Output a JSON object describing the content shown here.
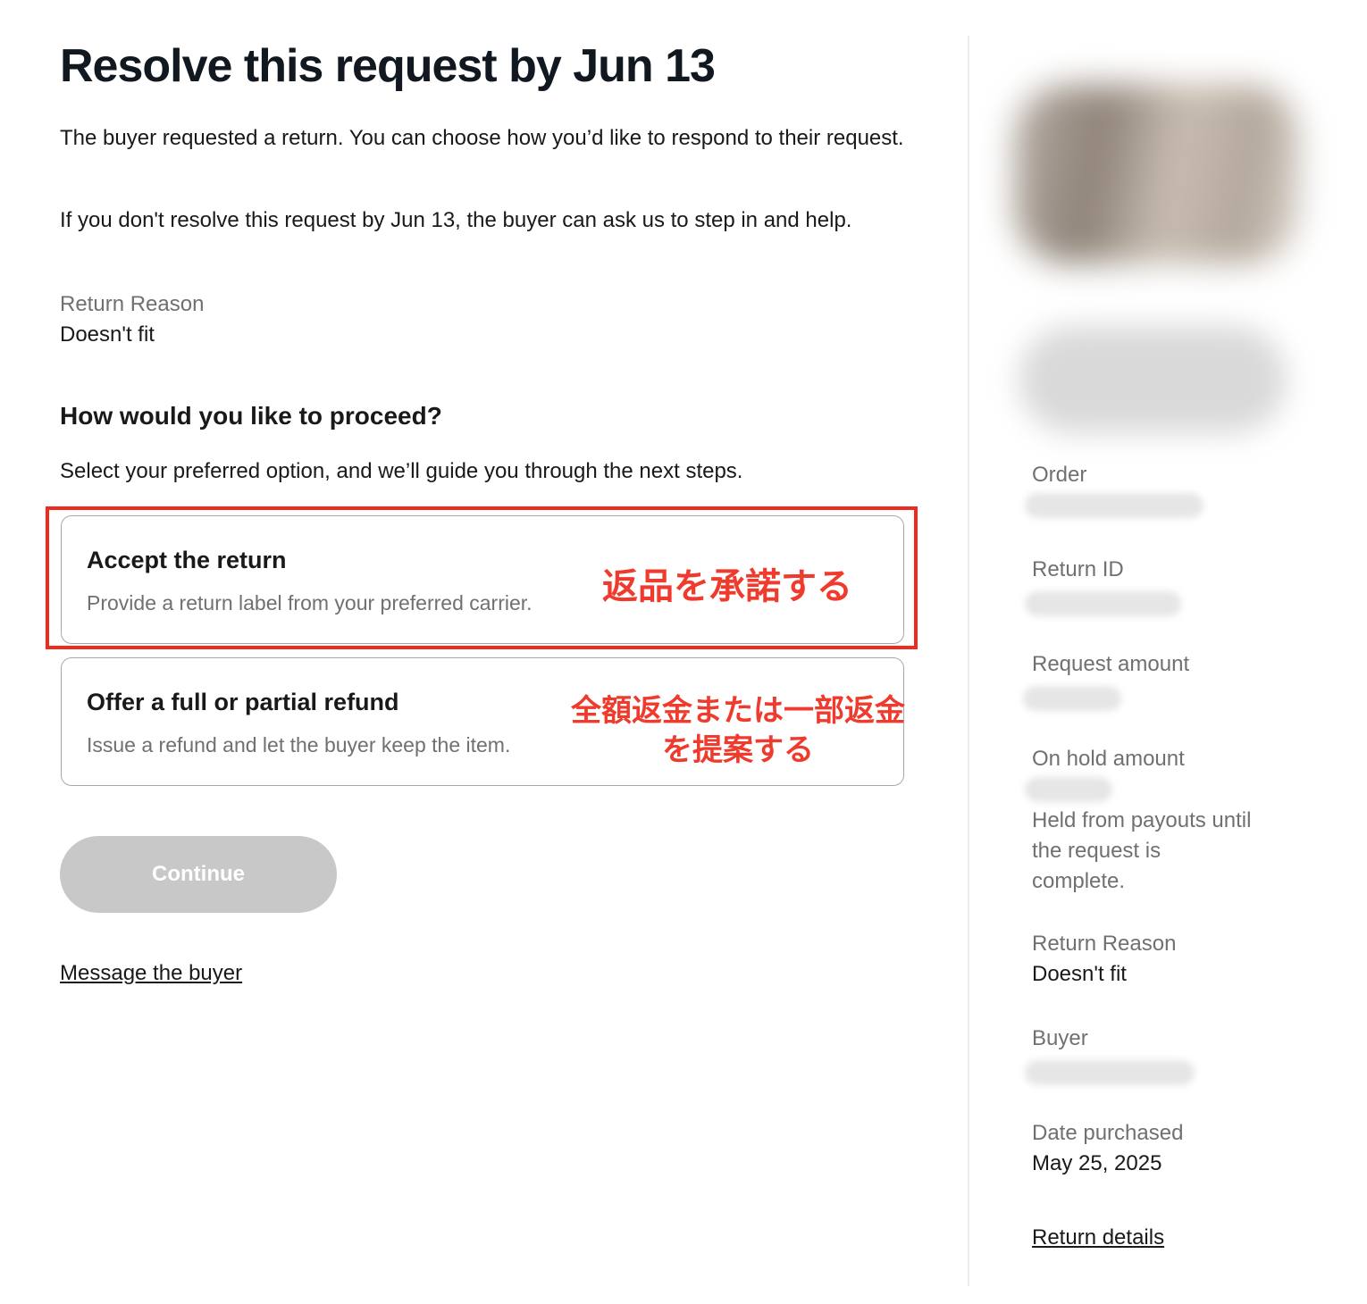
{
  "main": {
    "title": "Resolve this request by Jun 13",
    "intro_1": "The buyer requested a return. You can choose how you’d like to respond to their request.",
    "intro_2": "If you don't resolve this request by Jun 13, the buyer can ask us to step in and help.",
    "return_reason_label": "Return Reason",
    "return_reason_value": "Doesn't fit",
    "proceed_heading": "How would you like to proceed?",
    "proceed_sub": "Select your preferred option, and we’ll guide you through the next steps.",
    "options": [
      {
        "title": "Accept the return",
        "description": "Provide a return label from your preferred carrier.",
        "annotation": "返品を承諾する",
        "highlighted": true
      },
      {
        "title": "Offer a full or partial refund",
        "description": "Issue a refund and let the buyer keep the item.",
        "annotation": "全額返金または一部返金を提案する",
        "highlighted": false
      }
    ],
    "continue_label": "Continue",
    "message_link": "Message the buyer",
    "highlight_color": "#ef2b1f"
  },
  "sidebar": {
    "order_label": "Order",
    "return_id_label": "Return ID",
    "request_amount_label": "Request amount",
    "on_hold_label": "On hold amount",
    "on_hold_note": "Held from payouts until the request is complete.",
    "return_reason_label": "Return Reason",
    "return_reason_value": "Doesn't fit",
    "buyer_label": "Buyer",
    "date_purchased_label": "Date purchased",
    "date_purchased_value": "May 25, 2025",
    "return_details_link": "Return details"
  }
}
